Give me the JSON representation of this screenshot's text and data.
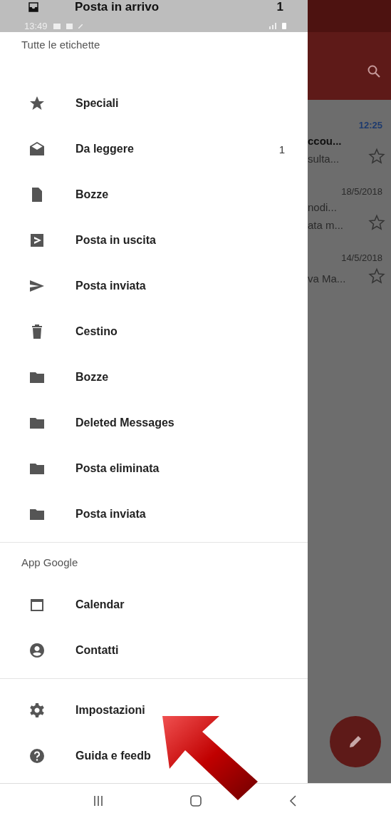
{
  "status_bar": {
    "time": "13:49"
  },
  "previous_row": {
    "label": "Posta in arrivo",
    "count": "1"
  },
  "sections": [
    {
      "title": "Tutte le etichette",
      "items": [
        {
          "kind": "star",
          "label": "Speciali"
        },
        {
          "kind": "unread",
          "label": "Da leggere",
          "count": "1"
        },
        {
          "kind": "draft",
          "label": "Bozze"
        },
        {
          "kind": "outbox",
          "label": "Posta in uscita"
        },
        {
          "kind": "sent",
          "label": "Posta inviata"
        },
        {
          "kind": "trash",
          "label": "Cestino"
        },
        {
          "kind": "folder",
          "label": "Bozze"
        },
        {
          "kind": "folder",
          "label": "Deleted Messages"
        },
        {
          "kind": "folder",
          "label": "Posta eliminata"
        },
        {
          "kind": "folder",
          "label": "Posta inviata"
        }
      ]
    },
    {
      "title": "App Google",
      "items": [
        {
          "kind": "calendar",
          "label": "Calendar"
        },
        {
          "kind": "contacts",
          "label": "Contatti"
        }
      ]
    },
    {
      "items": [
        {
          "kind": "settings",
          "label": "Impostazioni"
        },
        {
          "kind": "help",
          "label": "Guida e feedb"
        }
      ]
    }
  ],
  "messages": [
    {
      "time": "12:25",
      "unread": true,
      "lines": [
        "ccou...",
        "sulta..."
      ]
    },
    {
      "time": "18/5/2018",
      "unread": false,
      "lines": [
        "nodi...",
        "ata m..."
      ]
    },
    {
      "time": "14/5/2018",
      "unread": false,
      "lines": [
        "va Ma..."
      ]
    }
  ]
}
